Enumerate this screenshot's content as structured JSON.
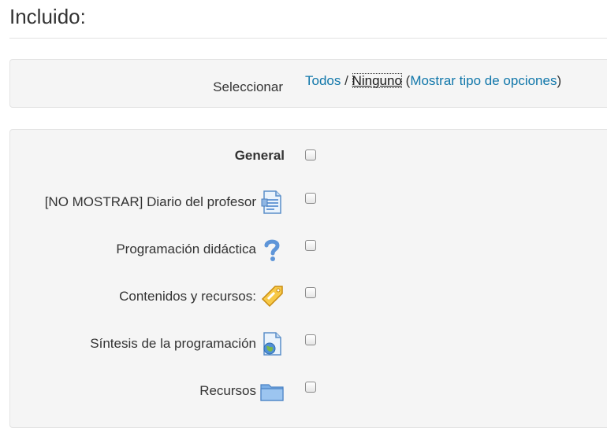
{
  "page": {
    "title": "Incluido:"
  },
  "selector": {
    "label": "Seleccionar",
    "all": "Todos",
    "separator": "/",
    "none": "Ninguno",
    "open_paren": "(",
    "options_link": "Mostrar tipo de opciones",
    "close_paren": ")"
  },
  "items": [
    {
      "label": "General",
      "icon": "none",
      "checked": false
    },
    {
      "label": "[NO MOSTRAR] Diario del profesor",
      "icon": "journal-page-icon",
      "checked": false
    },
    {
      "label": "Programación didáctica",
      "icon": "question-mark-icon",
      "checked": false
    },
    {
      "label": "Contenidos y recursos:",
      "icon": "label-tag-icon",
      "checked": false
    },
    {
      "label": "Síntesis de la programación",
      "icon": "web-page-globe-icon",
      "checked": false
    },
    {
      "label": "Recursos",
      "icon": "folder-icon",
      "checked": false
    }
  ],
  "colors": {
    "link": "#1177aa",
    "well_background": "#f5f5f5",
    "well_border": "#e3e3e3",
    "text": "#333333"
  }
}
